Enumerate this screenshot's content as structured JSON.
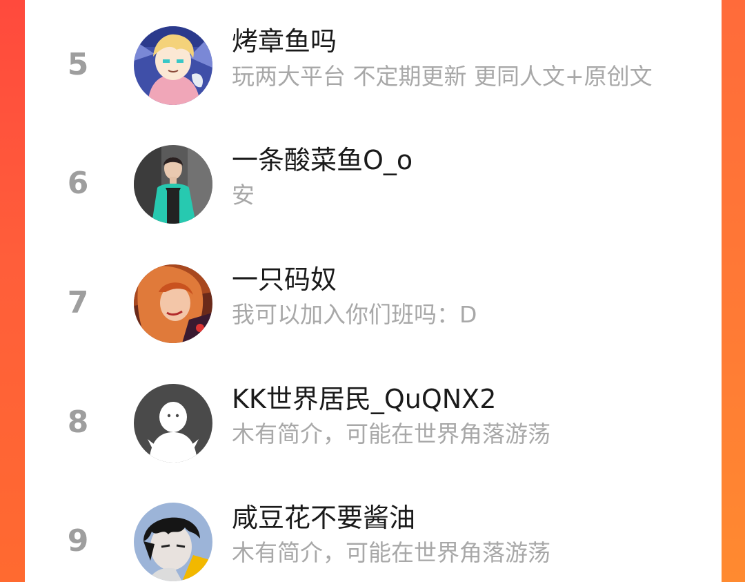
{
  "leaderboard": {
    "entries": [
      {
        "rank": "5",
        "name": "烤章鱼吗",
        "bio": "玩两大平台 不定期更新 更同人文+原创文",
        "avatar_icon": "anime-blonde-boy-avatar",
        "colors": {
          "bg": "#3f4fa8",
          "accent": "#f4d27a"
        }
      },
      {
        "rank": "6",
        "name": "一条酸菜鱼O_o",
        "bio": "安",
        "avatar_icon": "teal-jacket-person-avatar",
        "colors": {
          "bg": "#5a5a5a",
          "accent": "#27c9b0"
        }
      },
      {
        "rank": "7",
        "name": "一只码奴",
        "bio": "我可以加入你们班吗：D",
        "avatar_icon": "redhead-anime-girl-avatar",
        "colors": {
          "bg": "#6a2a1a",
          "accent": "#e07a3a"
        }
      },
      {
        "rank": "8",
        "name": "KK世界居民_QuQNX2",
        "bio": "木有简介，可能在世界角落游荡",
        "avatar_icon": "default-ghost-avatar",
        "colors": {
          "bg": "#4a4a4a",
          "accent": "#ffffff"
        }
      },
      {
        "rank": "9",
        "name": "咸豆花不要酱油",
        "bio": "木有简介，可能在世界角落游荡",
        "avatar_icon": "dark-hair-boy-avatar",
        "colors": {
          "bg": "#9cb4d8",
          "accent": "#f2b800"
        }
      }
    ]
  },
  "theme": {
    "frame_color": "#ff5a3a",
    "rank_color": "#9e9e9e",
    "name_color": "#1a1a1a",
    "bio_color": "#a8a8a8"
  }
}
